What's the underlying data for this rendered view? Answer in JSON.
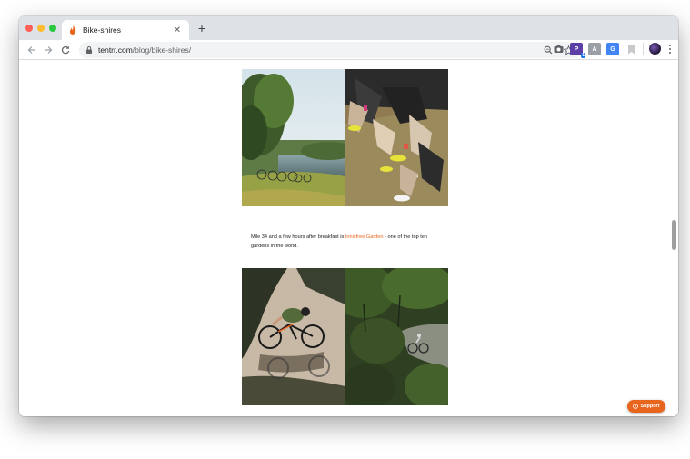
{
  "browser": {
    "tab": {
      "title": "Bike-shires",
      "close_icon": "close-icon"
    },
    "new_tab_icon": "plus-icon",
    "address": {
      "host": "tentrr.com",
      "path": "/blog/bike-shires/"
    },
    "extensions": [
      {
        "name": "camera-icon",
        "label": ""
      },
      {
        "name": "extension-p-icon",
        "label": "P",
        "badge": "1"
      },
      {
        "name": "extension-a-icon",
        "label": "A"
      },
      {
        "name": "translate-icon",
        "label": "G"
      },
      {
        "name": "bookmark-ext-icon",
        "label": ""
      }
    ]
  },
  "content": {
    "caption": {
      "before": "Mile 34 and a few hours after breakfast is ",
      "link": "Innisfree Garden",
      "after": " - one of the top ten gardens in the world."
    }
  },
  "support_button": {
    "label": "Support"
  },
  "colors": {
    "accent": "#e8651e",
    "tab_strip": "#dee1e6",
    "omnibox": "#f1f3f4"
  }
}
